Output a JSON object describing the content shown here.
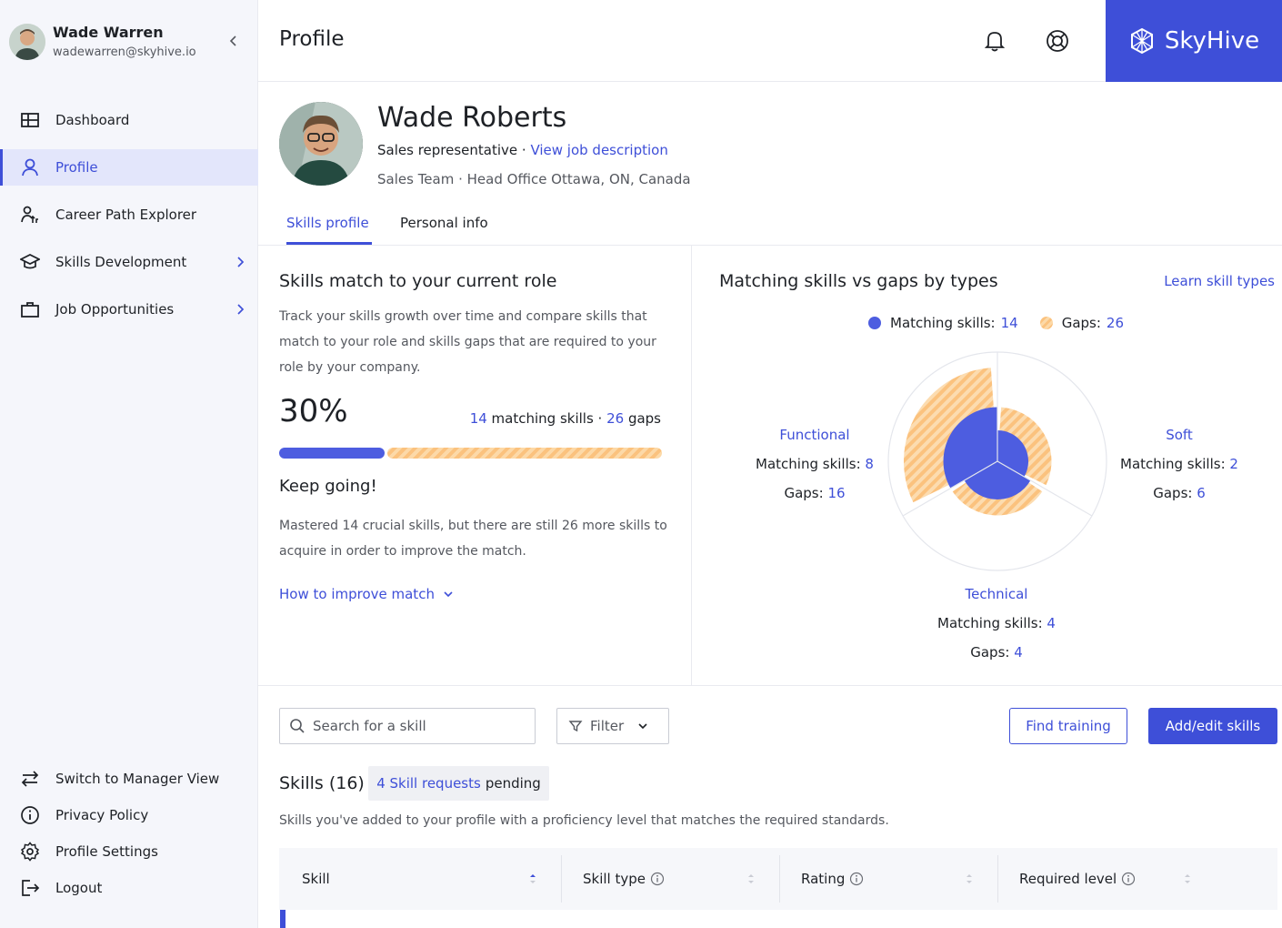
{
  "user": {
    "name": "Wade Warren",
    "email": "wadewarren@skyhive.io"
  },
  "nav": {
    "items": [
      {
        "label": "Dashboard",
        "icon": "dashboard-icon"
      },
      {
        "label": "Profile",
        "icon": "user-icon",
        "active": true
      },
      {
        "label": "Career Path Explorer",
        "icon": "career-path-icon"
      },
      {
        "label": "Skills Development",
        "icon": "graduation-cap-icon",
        "expandable": true
      },
      {
        "label": "Job Opportunities",
        "icon": "briefcase-icon",
        "expandable": true
      }
    ],
    "bottom": [
      {
        "label": "Switch to Manager View",
        "icon": "swap-icon"
      },
      {
        "label": "Privacy Policy",
        "icon": "info-icon"
      },
      {
        "label": "Profile Settings",
        "icon": "gear-icon"
      },
      {
        "label": "Logout",
        "icon": "logout-icon"
      }
    ]
  },
  "header": {
    "title": "Profile",
    "brand": "SkyHive"
  },
  "profile": {
    "name": "Wade Roberts",
    "role": "Sales representative",
    "separator": " · ",
    "job_link": "View job description",
    "location": "Sales Team · Head Office Ottawa, ON, Canada"
  },
  "tabs": [
    {
      "label": "Skills profile",
      "active": true
    },
    {
      "label": "Personal info"
    }
  ],
  "skills_match": {
    "title": "Skills match to your current role",
    "description": "Track your skills growth over time and compare skills that match to your role and skills gaps that are required to your role by your company.",
    "percent": "30%",
    "match_progress": 0.3,
    "matching_count": "14",
    "matching_label": " matching skills · ",
    "gaps_count": "26",
    "gaps_label": " gaps",
    "encourage_title": "Keep going!",
    "encourage_text": "Mastered 14 crucial skills, but there are still 26 more skills to acquire in order to improve the match.",
    "improve_link": "How to improve match"
  },
  "types_chart": {
    "title": "Matching skills vs gaps by types",
    "learn_link": "Learn skill types",
    "legend": {
      "matching_label": "Matching skills:",
      "matching_value": "14",
      "gaps_label": "Gaps:",
      "gaps_value": "26"
    },
    "colors": {
      "matching": "#4d5de0",
      "gaps": "#fbc27e"
    },
    "matching_prefix": "Matching skills: ",
    "gaps_prefix": "Gaps: ",
    "categories": [
      {
        "name": "Functional",
        "matching": "8",
        "gaps": "16"
      },
      {
        "name": "Soft",
        "matching": "2",
        "gaps": "6"
      },
      {
        "name": "Technical",
        "matching": "4",
        "gaps": "4"
      }
    ]
  },
  "chart_data": {
    "type": "radial-bar",
    "categories": [
      "Functional",
      "Soft",
      "Technical"
    ],
    "series": [
      {
        "name": "Matching skills",
        "values": [
          8,
          2,
          4
        ]
      },
      {
        "name": "Gaps",
        "values": [
          16,
          6,
          4
        ]
      }
    ],
    "legend_position": "top"
  },
  "skills_list": {
    "search_placeholder": "Search for a skill",
    "filter_label": "Filter",
    "find_training": "Find training",
    "add_edit": "Add/edit skills",
    "title": "Skills (16)",
    "pending_link": "4 Skill requests",
    "pending_suffix": "pending",
    "description": "Skills you've added to your profile with a proficiency level that matches the required standards.",
    "columns": [
      "Skill",
      "Skill type",
      "Rating",
      "Required level"
    ]
  }
}
